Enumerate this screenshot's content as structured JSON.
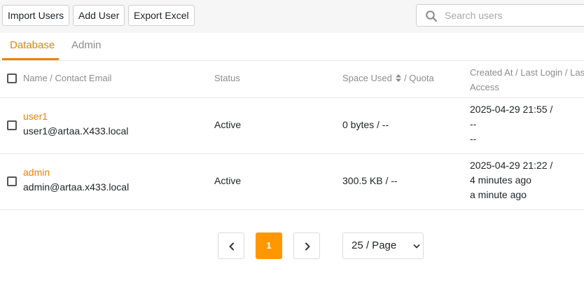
{
  "toolbar": {
    "import_label": "Import Users",
    "add_label": "Add User",
    "export_label": "Export Excel",
    "search_placeholder": "Search users"
  },
  "tabs": [
    {
      "label": "Database",
      "active": true
    },
    {
      "label": "Admin",
      "active": false
    }
  ],
  "table": {
    "headers": {
      "name": "Name / Contact Email",
      "status": "Status",
      "space_used": "Space Used",
      "quota_sep": "/ Quota",
      "created_line1": "Created At / Last Login / Last",
      "created_line2": "Access"
    },
    "rows": [
      {
        "name": "user1",
        "email": "user1@artaa.X433.local",
        "status": "Active",
        "space": "0 bytes / --",
        "created": "2025-04-29 21:55 /",
        "last_login": "--",
        "last_access": "--"
      },
      {
        "name": "admin",
        "email": "admin@artaa.x433.local",
        "status": "Active",
        "space": "300.5 KB / --",
        "created": "2025-04-29 21:22 /",
        "last_login": "4 minutes ago",
        "last_access": "a minute ago"
      }
    ]
  },
  "pagination": {
    "current_page": "1",
    "per_page": "25 / Page"
  },
  "icons": {
    "search": "search-icon",
    "sort": "sort-icon",
    "prev": "chevron-left-icon",
    "next": "chevron-right-icon",
    "dropdown": "chevron-down-icon"
  },
  "colors": {
    "accent": "#eb8205",
    "pagination_active": "#ff9800",
    "toolbar_bg": "#f6f6f6"
  }
}
